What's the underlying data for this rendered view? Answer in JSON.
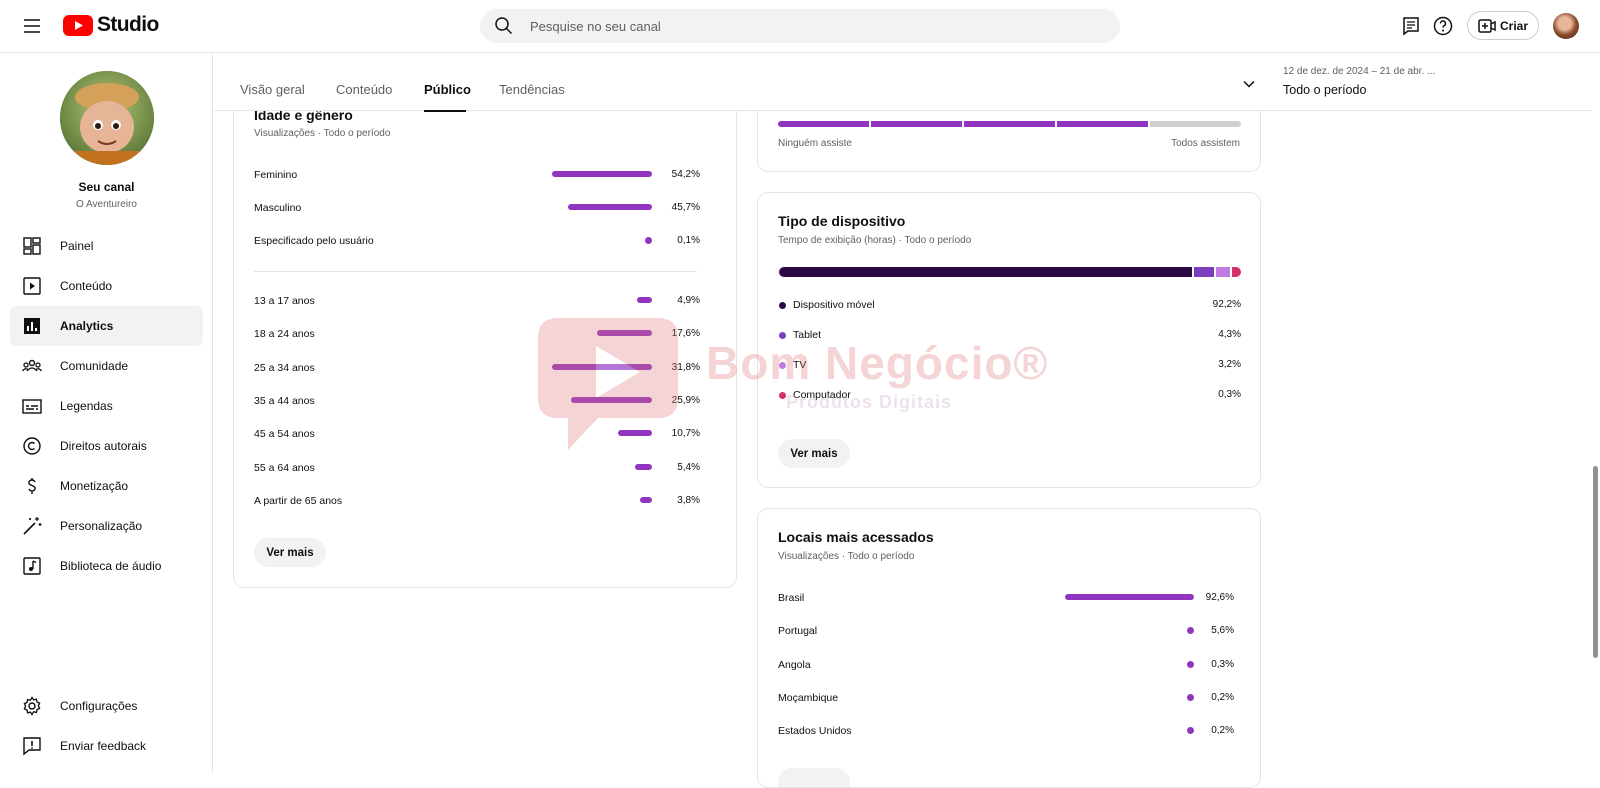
{
  "header": {
    "logo_text": "Studio",
    "search_placeholder": "Pesquise no seu canal",
    "create_label": "Criar"
  },
  "sidebar": {
    "channel_name": "Seu canal",
    "channel_sub": "O Aventureiro",
    "items": [
      {
        "label": "Painel",
        "icon": "dashboard-icon"
      },
      {
        "label": "Conteúdo",
        "icon": "content-icon"
      },
      {
        "label": "Analytics",
        "icon": "analytics-icon",
        "active": true
      },
      {
        "label": "Comunidade",
        "icon": "community-icon"
      },
      {
        "label": "Legendas",
        "icon": "subtitles-icon"
      },
      {
        "label": "Direitos autorais",
        "icon": "copyright-icon"
      },
      {
        "label": "Monetização",
        "icon": "monetization-icon"
      },
      {
        "label": "Personalização",
        "icon": "customization-icon"
      },
      {
        "label": "Biblioteca de áudio",
        "icon": "audio-library-icon"
      }
    ],
    "bottom_items": [
      {
        "label": "Configurações",
        "icon": "settings-icon"
      },
      {
        "label": "Enviar feedback",
        "icon": "feedback-icon"
      }
    ]
  },
  "tabs": {
    "items": [
      "Visão geral",
      "Conteúdo",
      "Público",
      "Tendências"
    ],
    "active": "Público"
  },
  "period": {
    "range": "12 de dez. de 2024 – 21 de abr. ...",
    "label": "Todo o período"
  },
  "age_gender": {
    "title": "Idade e gênero",
    "subtitle": "Visualizações · Todo o período",
    "gender": [
      {
        "label": "Feminino",
        "value": "54,2%",
        "share": 54.2
      },
      {
        "label": "Masculino",
        "value": "45,7%",
        "share": 45.7
      },
      {
        "label": "Especificado pelo usuário",
        "value": "0,1%",
        "share": 0.1
      }
    ],
    "ages": [
      {
        "label": "13 a 17 anos",
        "value": "4,9%",
        "share": 4.9
      },
      {
        "label": "18 a 24 anos",
        "value": "17,6%",
        "share": 17.6
      },
      {
        "label": "25 a 34 anos",
        "value": "31,8%",
        "share": 31.8
      },
      {
        "label": "35 a 44 anos",
        "value": "25,9%",
        "share": 25.9
      },
      {
        "label": "45 a 54 anos",
        "value": "10,7%",
        "share": 10.7
      },
      {
        "label": "55 a 64 anos",
        "value": "5,4%",
        "share": 5.4
      },
      {
        "label": "A partir de 65 anos",
        "value": "3,8%",
        "share": 3.8
      }
    ],
    "more_label": "Ver mais"
  },
  "watch_scale": {
    "left_label": "Ninguém assiste",
    "right_label": "Todos assistem",
    "filled_segments": 4,
    "total_segments": 5
  },
  "device": {
    "title": "Tipo de dispositivo",
    "subtitle": "Tempo de exibição (horas) · Todo o período",
    "items": [
      {
        "label": "Dispositivo móvel",
        "value": "92,2%",
        "share": 92.2,
        "color": "#2a0a45"
      },
      {
        "label": "Tablet",
        "value": "4,3%",
        "share": 4.3,
        "color": "#7b3fbf"
      },
      {
        "label": "TV",
        "value": "3,2%",
        "share": 3.2,
        "color": "#c07be0"
      },
      {
        "label": "Computador",
        "value": "0,3%",
        "share": 0.3,
        "color": "#d4306c"
      }
    ],
    "more_label": "Ver mais"
  },
  "locations": {
    "title": "Locais mais acessados",
    "subtitle": "Visualizações · Todo o período",
    "items": [
      {
        "label": "Brasil",
        "value": "92,6%",
        "share": 92.6
      },
      {
        "label": "Portugal",
        "value": "5,6%",
        "share": 5.6
      },
      {
        "label": "Angola",
        "value": "0,3%",
        "share": 0.3
      },
      {
        "label": "Moçambique",
        "value": "0,2%",
        "share": 0.2
      },
      {
        "label": "Estados Unidos",
        "value": "0,2%",
        "share": 0.2
      }
    ]
  },
  "watermark": {
    "brand": "Bom Negócio®",
    "sub": "Produtos Digitais"
  },
  "colors": {
    "accent": "#9135c1",
    "youtube_red": "#ff0000"
  }
}
